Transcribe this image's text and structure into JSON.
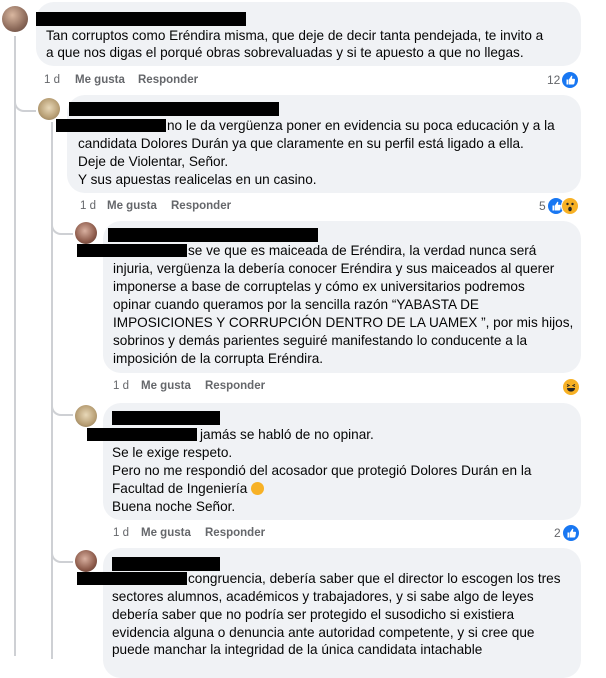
{
  "comments": [
    {
      "lines": [
        "Tan corruptos como Eréndira misma, que deje de decir tanta pendejada, te invito a",
        "a que nos digas el porqué obras sobrevaluadas y si te apuesto a que no llegas."
      ],
      "time": "1 d",
      "like_label": "Me gusta",
      "reply_label": "Responder",
      "reaction_count": "12",
      "reactions": [
        "like"
      ]
    },
    {
      "lines": [
        "no le da vergüenza poner en evidencia su poca educación y a la",
        "candidata Dolores Durán ya que claramente en su perfil está ligado a ella.",
        "Deje de Violentar, Señor.",
        "Y sus apuestas realicelas en un casino."
      ],
      "time": "1 d",
      "like_label": "Me gusta",
      "reply_label": "Responder",
      "reaction_count": "5",
      "reactions": [
        "like",
        "wow"
      ]
    },
    {
      "lines": [
        "se ve que es maiceada de Eréndira, la verdad nunca será",
        "injuria, vergüenza la debería conocer Eréndira y sus maiceados al querer",
        "imponerse a base de corruptelas y cómo ex universitarios podremos",
        "opinar cuando queramos por la sencilla razón “YABASTA DE",
        "IMPOSICIONES Y CORRUPCIÓN DENTRO DE LA UAMEX ”, por mis hijos,",
        "sobrinos y demás parientes seguiré manifestando lo conducente a la",
        "imposición de la corrupta Eréndira."
      ],
      "time": "1 d",
      "like_label": "Me gusta",
      "reply_label": "Responder",
      "reaction_count": "",
      "reactions": [
        "haha"
      ]
    },
    {
      "lines": [
        "jamás se habló de no opinar.",
        "Se le exige respeto.",
        "Pero no me respondió del acosador que protegió Dolores Durán en la",
        "Facultad de Ingeniería",
        "Buena noche Señor."
      ],
      "time": "1 d",
      "like_label": "Me gusta",
      "reply_label": "Responder",
      "reaction_count": "2",
      "reactions": [
        "like"
      ]
    },
    {
      "lines": [
        "congruencia, debería saber que el director lo escogen los tres",
        "sectores alumnos, académicos y trabajadores, y si sabe algo de leyes",
        "debería saber que no podría ser protegido el susodicho si existiera",
        "evidencia alguna o denuncia ante autoridad competente, y si cree que",
        "puede manchar la integridad de la única candidata intachable"
      ]
    }
  ],
  "colors": {
    "like": "#1877f2",
    "bubble": "#f0f2f5",
    "meta": "#65676b",
    "thread": "#ced0d4"
  }
}
